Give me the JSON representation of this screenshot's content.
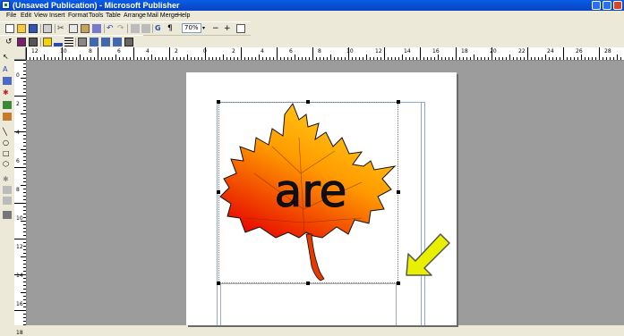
{
  "window": {
    "title": "(Unsaved Publication) - Microsoft Publisher"
  },
  "menu": [
    "File",
    "Edit",
    "View",
    "Insert",
    "Format",
    "Tools",
    "Table",
    "Arrange",
    "Mail Merge",
    "Help"
  ],
  "toolbar": {
    "zoom_value": "70%",
    "zoom_out": "−",
    "zoom_in": "+"
  },
  "ruler": {
    "h_labels": [
      "12",
      "10",
      "8",
      "6",
      "4",
      "2",
      "0",
      "2",
      "4",
      "6",
      "8",
      "10",
      "12",
      "14",
      "16",
      "18",
      "20",
      "22",
      "24",
      "26",
      "28"
    ],
    "v_labels": [
      "0",
      "2",
      "4",
      "6",
      "8",
      "10",
      "12",
      "14",
      "16",
      "18"
    ]
  },
  "document": {
    "word": "are"
  },
  "colors": {
    "titlebar": "#0a5ce6",
    "canvas": "#9c9c9c",
    "arrow": "#e8f000",
    "leaf_top": "#ffd21a",
    "leaf_bottom": "#e60000"
  }
}
